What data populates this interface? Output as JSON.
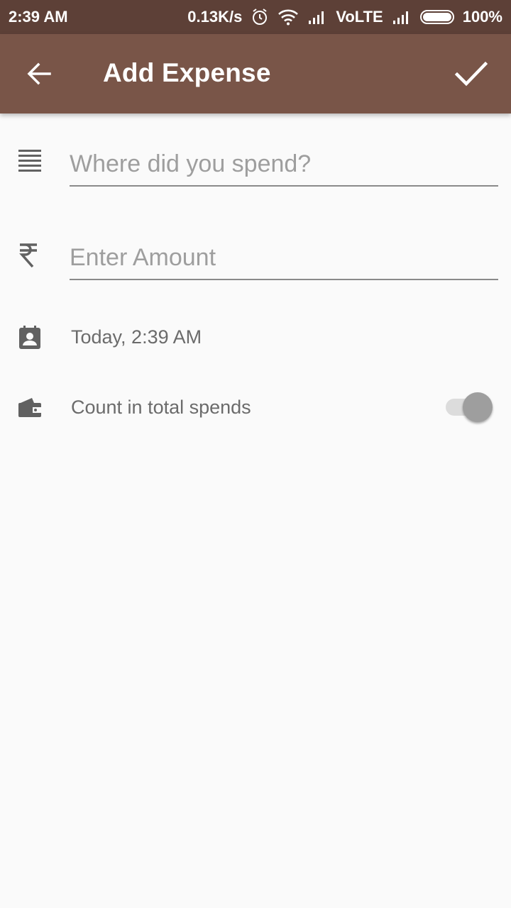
{
  "status_bar": {
    "time": "2:39 AM",
    "net_speed": "0.13K/s",
    "carrier": "VoLTE",
    "battery": "100%",
    "icons": [
      "alarm-icon",
      "wifi-icon",
      "signal-icon",
      "signal-icon",
      "battery-icon"
    ]
  },
  "app_bar": {
    "title": "Add Expense",
    "back_icon": "arrow-back-icon",
    "confirm_icon": "check-icon"
  },
  "form": {
    "place_field": {
      "icon": "notes-icon",
      "placeholder": "Where did you spend?",
      "value": ""
    },
    "amount_field": {
      "icon": "rupee-icon",
      "placeholder": "Enter Amount",
      "value": ""
    },
    "date": {
      "icon": "calendar-icon",
      "text": "Today, 2:39 AM"
    },
    "count_toggle": {
      "icon": "wallet-icon",
      "label": "Count in total spends",
      "enabled": true
    }
  },
  "colors": {
    "status_bar": "#5d4037",
    "app_bar": "#795548",
    "background": "#fafafa"
  }
}
